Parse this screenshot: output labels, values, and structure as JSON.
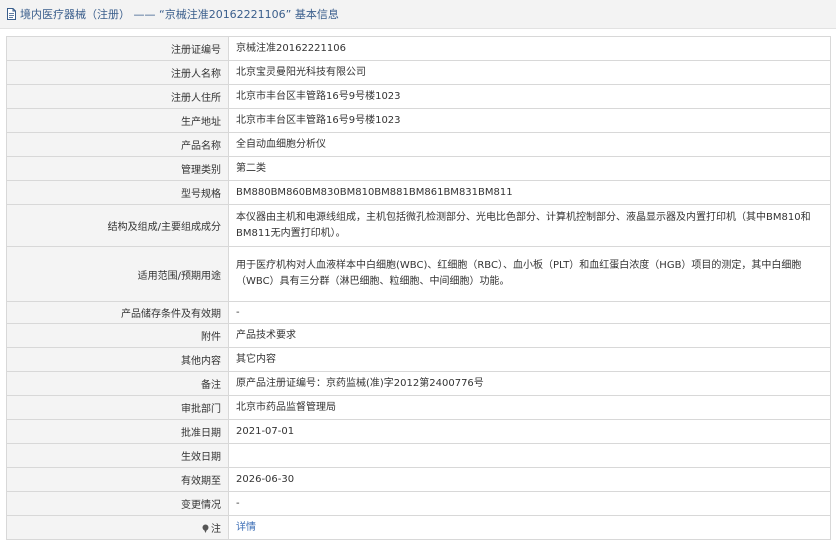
{
  "header": {
    "title": "境内医疗器械（注册） —— “京械注准20162221106” 基本信息"
  },
  "rows": [
    {
      "label": "注册证编号",
      "value": "京械注准20162221106",
      "h": 24
    },
    {
      "label": "注册人名称",
      "value": "北京宝灵曼阳光科技有限公司",
      "h": 24
    },
    {
      "label": "注册人住所",
      "value": "北京市丰台区丰管路16号9号楼1023",
      "h": 24
    },
    {
      "label": "生产地址",
      "value": "北京市丰台区丰管路16号9号楼1023",
      "h": 24
    },
    {
      "label": "产品名称",
      "value": "全自动血细胞分析仪",
      "h": 24
    },
    {
      "label": "管理类别",
      "value": "第二类",
      "h": 24
    },
    {
      "label": "型号规格",
      "value": "BM880BM860BM830BM810BM881BM861BM831BM811",
      "h": 24
    },
    {
      "label": "结构及组成/主要组成成分",
      "value": "本仪器由主机和电源线组成，主机包括微孔检测部分、光电比色部分、计算机控制部分、液晶显示器及内置打印机（其中BM810和BM811无内置打印机）。",
      "h": 42
    },
    {
      "label": "适用范围/预期用途",
      "value": "用于医疗机构对人血液样本中白细胞(WBC)、红细胞（RBC）、血小板（PLT）和血红蛋白浓度（HGB）项目的测定，其中白细胞（WBC）具有三分群（淋巴细胞、粒细胞、中间细胞）功能。",
      "h": 55
    },
    {
      "label": "产品储存条件及有效期",
      "value": "-",
      "h": 22
    },
    {
      "label": "附件",
      "value": "产品技术要求",
      "h": 24
    },
    {
      "label": "其他内容",
      "value": "其它内容",
      "h": 24
    },
    {
      "label": "备注",
      "value": "原产品注册证编号：京药监械(准)字2012第2400776号",
      "h": 24
    },
    {
      "label": "审批部门",
      "value": "北京市药品监督管理局",
      "h": 24
    },
    {
      "label": "批准日期",
      "value": "2021-07-01",
      "h": 24
    },
    {
      "label": "生效日期",
      "value": "",
      "h": 24
    },
    {
      "label": "有效期至",
      "value": "2026-06-30",
      "h": 24
    },
    {
      "label": "变更情况",
      "value": "-",
      "h": 24
    }
  ],
  "note_row": {
    "label": "注",
    "link": "详情"
  }
}
